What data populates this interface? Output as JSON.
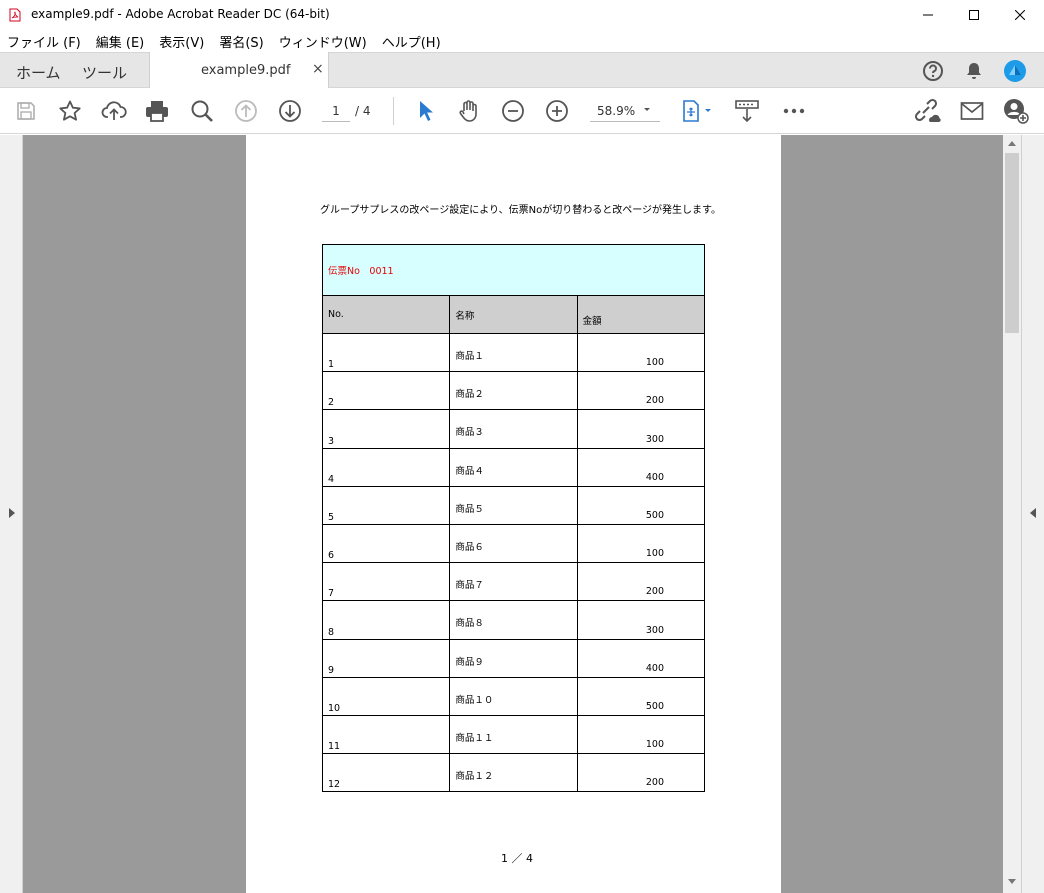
{
  "window": {
    "title": "example9.pdf - Adobe Acrobat Reader DC (64-bit)"
  },
  "menu": [
    "ファイル (F)",
    "編集 (E)",
    "表示(V)",
    "署名(S)",
    "ウィンドウ(W)",
    "ヘルプ(H)"
  ],
  "tabs": {
    "home": "ホーム",
    "tools": "ツール",
    "document": "example9.pdf",
    "close": "×"
  },
  "toolbar": {
    "page_current": "1",
    "page_total": "/ 4",
    "zoom": "58.9%"
  },
  "icons": [
    "pdf-file-icon",
    "minimize-icon",
    "maximize-icon",
    "close-icon",
    "help-icon",
    "bell-icon",
    "account-icon",
    "save-icon",
    "star-icon",
    "cloud-upload-icon",
    "print-icon",
    "zoom-search-icon",
    "page-up-icon",
    "page-down-icon",
    "select-cursor-icon",
    "hand-icon",
    "zoom-out-icon",
    "zoom-in-icon",
    "chevron-down-icon",
    "fit-page-icon",
    "scroll-mode-icon",
    "more-icon",
    "share-link-icon",
    "mail-icon",
    "add-user-icon"
  ],
  "colors": {
    "accent": "#2a7ad0",
    "slip_header_bg": "#d8ffff",
    "slip_header_text": "#e60000",
    "table_header_bg": "#cfcfcf",
    "doc_background": "#9a9a9a"
  },
  "document": {
    "intro": "グループサプレスの改ページ設定により、伝票Noが切り替わると改ページが発生します。",
    "slip": "伝票No　0011",
    "headers": {
      "no": "No.",
      "name": "名称",
      "amount": "金額"
    },
    "rows": [
      {
        "no": "1",
        "name": "商品１",
        "amount": "100"
      },
      {
        "no": "2",
        "name": "商品２",
        "amount": "200"
      },
      {
        "no": "3",
        "name": "商品３",
        "amount": "300"
      },
      {
        "no": "4",
        "name": "商品４",
        "amount": "400"
      },
      {
        "no": "5",
        "name": "商品５",
        "amount": "500"
      },
      {
        "no": "6",
        "name": "商品６",
        "amount": "100"
      },
      {
        "no": "7",
        "name": "商品７",
        "amount": "200"
      },
      {
        "no": "8",
        "name": "商品８",
        "amount": "300"
      },
      {
        "no": "9",
        "name": "商品９",
        "amount": "400"
      },
      {
        "no": "10",
        "name": "商品１０",
        "amount": "500"
      },
      {
        "no": "11",
        "name": "商品１１",
        "amount": "100"
      },
      {
        "no": "12",
        "name": "商品１２",
        "amount": "200"
      }
    ],
    "footer": "1 ／ 4"
  }
}
